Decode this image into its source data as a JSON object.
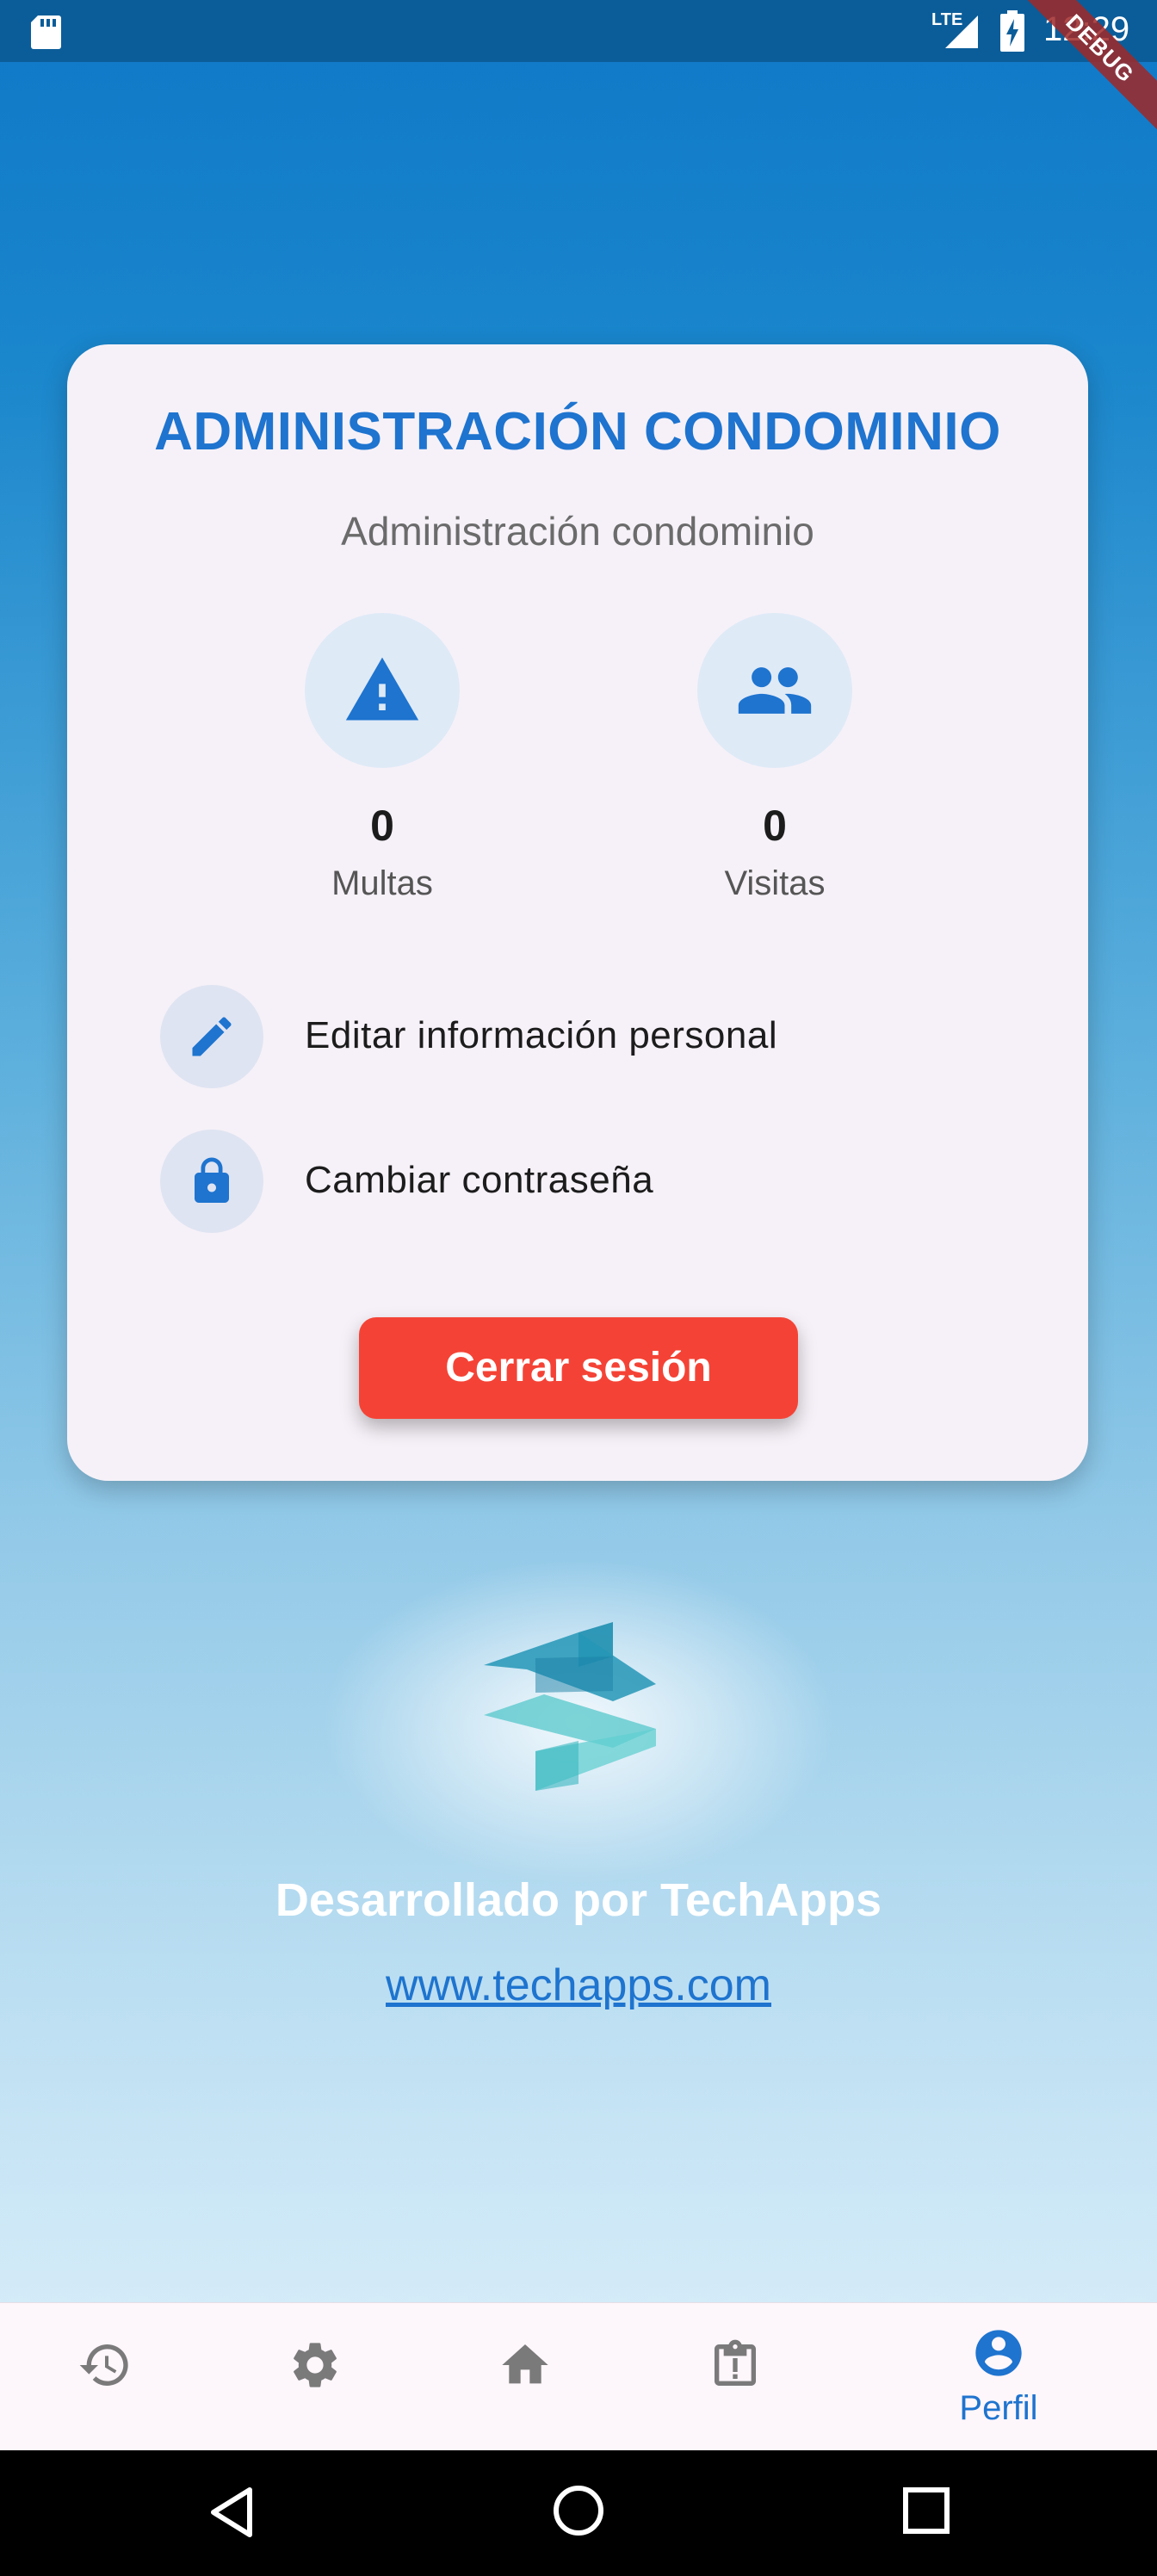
{
  "status_bar": {
    "time": "12:29",
    "network_label": "LTE",
    "debug_banner": "DEBUG",
    "icons": [
      "sd-card-icon",
      "signal-icon",
      "battery-charging-icon"
    ]
  },
  "profile_card": {
    "title": "ADMINISTRACIÓN CONDOMINIO",
    "subtitle": "Administración condominio",
    "stats": [
      {
        "icon": "warning-icon",
        "value": "0",
        "label": "Multas"
      },
      {
        "icon": "people-icon",
        "value": "0",
        "label": "Visitas"
      }
    ],
    "options": [
      {
        "icon": "edit-icon",
        "label": "Editar información personal"
      },
      {
        "icon": "lock-icon",
        "label": "Cambiar contraseña"
      }
    ],
    "logout_label": "Cerrar sesión"
  },
  "branding": {
    "developer_text": "Desarrollado por TechApps",
    "website": "www.techapps.com"
  },
  "bottom_nav": {
    "items": [
      {
        "icon": "history-icon",
        "label": ""
      },
      {
        "icon": "settings-icon",
        "label": ""
      },
      {
        "icon": "home-icon",
        "label": ""
      },
      {
        "icon": "report-icon",
        "label": ""
      },
      {
        "icon": "profile-icon",
        "label": "Perfil",
        "active": true
      }
    ]
  },
  "colors": {
    "primary": "#1e74cf",
    "logout": "#f44336",
    "card_background": "#f6f1f8",
    "status_bar": "#0b5d99"
  }
}
